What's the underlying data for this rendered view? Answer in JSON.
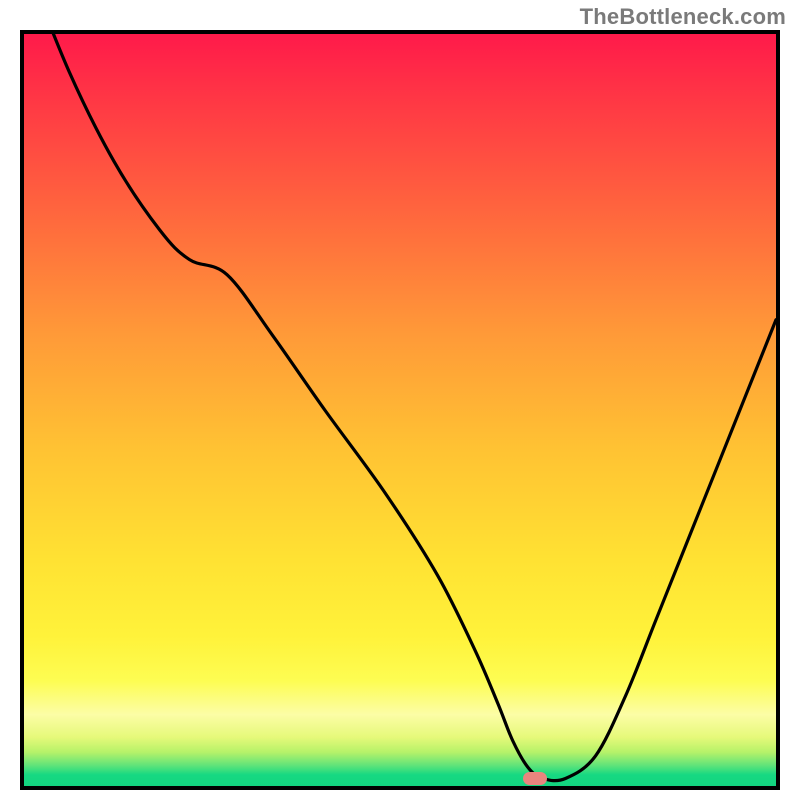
{
  "watermark": {
    "text": "TheBottleneck.com"
  },
  "colors": {
    "border": "#000000",
    "curve": "#000000",
    "marker": "#e9857e",
    "gradient_stops": [
      {
        "offset": 0.0,
        "color": "#ff1a4a"
      },
      {
        "offset": 0.1,
        "color": "#ff3b44"
      },
      {
        "offset": 0.25,
        "color": "#ff6a3d"
      },
      {
        "offset": 0.4,
        "color": "#ff9a38"
      },
      {
        "offset": 0.55,
        "color": "#ffc233"
      },
      {
        "offset": 0.7,
        "color": "#ffe233"
      },
      {
        "offset": 0.8,
        "color": "#fff23a"
      },
      {
        "offset": 0.86,
        "color": "#fdfd52"
      },
      {
        "offset": 0.905,
        "color": "#fcfda6"
      },
      {
        "offset": 0.935,
        "color": "#e6f97a"
      },
      {
        "offset": 0.955,
        "color": "#b6f269"
      },
      {
        "offset": 0.972,
        "color": "#63e479"
      },
      {
        "offset": 0.985,
        "color": "#17d982"
      },
      {
        "offset": 1.0,
        "color": "#12d47f"
      }
    ]
  },
  "chart_data": {
    "type": "line",
    "title": "",
    "xlabel": "",
    "ylabel": "",
    "xlim": [
      0,
      100
    ],
    "ylim": [
      0,
      100
    ],
    "grid": false,
    "legend": false,
    "x": [
      0,
      6,
      12,
      18,
      22,
      27,
      33,
      40,
      48,
      55,
      60,
      63,
      65,
      67,
      69,
      72,
      76,
      80,
      84,
      88,
      92,
      96,
      100
    ],
    "values": [
      110,
      95,
      83,
      74,
      70,
      68,
      60,
      50,
      39,
      28,
      18,
      11,
      6,
      2.5,
      1,
      1,
      4,
      12,
      22,
      32,
      42,
      52,
      62
    ],
    "series": [
      {
        "name": "bottleneck-curve",
        "x": [
          0,
          6,
          12,
          18,
          22,
          27,
          33,
          40,
          48,
          55,
          60,
          63,
          65,
          67,
          69,
          72,
          76,
          80,
          84,
          88,
          92,
          96,
          100
        ],
        "y": [
          110,
          95,
          83,
          74,
          70,
          68,
          60,
          50,
          39,
          28,
          18,
          11,
          6,
          2.5,
          1,
          1,
          4,
          12,
          22,
          32,
          42,
          52,
          62
        ]
      }
    ],
    "marker": {
      "x": 68,
      "y": 1,
      "width_pct": 3.2,
      "height_pct": 1.8
    },
    "note": "y clipped to [0,100]; curve begins above visible top edge"
  }
}
